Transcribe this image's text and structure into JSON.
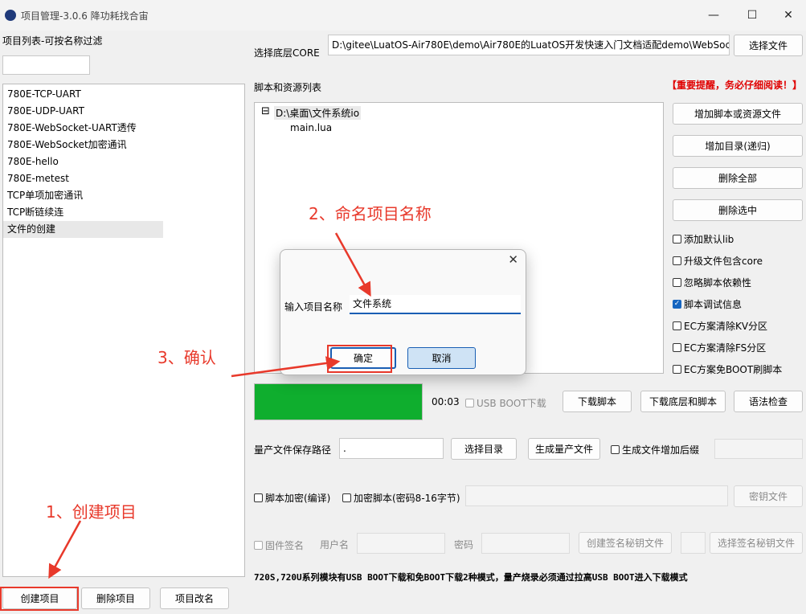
{
  "window": {
    "title": "项目管理-3.0.6 降功耗找合宙",
    "minimize_icon": "—",
    "maximize_icon": "☐",
    "close_icon": "✕"
  },
  "left": {
    "filter_label": "项目列表-可按名称过滤",
    "filter_value": "",
    "projects": [
      "780E-TCP-UART",
      "780E-UDP-UART",
      "780E-WebSocket-UART透传",
      "780E-WebSocket加密通讯",
      "780E-hello",
      "780E-metest",
      "TCP单项加密通讯",
      "TCP断链续连",
      "文件的创建"
    ],
    "selected_index": 8,
    "create_button": "创建项目",
    "delete_button": "删除项目",
    "rename_button": "项目改名"
  },
  "core": {
    "label": "选择底层CORE",
    "path": "D:\\gitee\\LuatOS-Air780E\\demo\\Air780E的LuatOS开发快速入门文档适配demo\\WebSock",
    "button": "选择文件"
  },
  "scripts": {
    "label": "脚本和资源列表",
    "warning": "【重要提醒，务必仔细阅读！】",
    "tree_root": "D:\\桌面\\文件系统io",
    "tree_collapse": "⊟",
    "tree_children": [
      "main.lua"
    ],
    "buttons": [
      "增加脚本或资源文件",
      "增加目录(递归)",
      "删除全部",
      "删除选中"
    ],
    "options": [
      {
        "label": "添加默认lib",
        "checked": false
      },
      {
        "label": "升级文件包含core",
        "checked": false
      },
      {
        "label": "忽略脚本依赖性",
        "checked": false
      },
      {
        "label": "脚本调试信息",
        "checked": true
      },
      {
        "label": "EC方案清除KV分区",
        "checked": false
      },
      {
        "label": "EC方案清除FS分区",
        "checked": false
      },
      {
        "label": "EC方案免BOOT刷脚本",
        "checked": false
      }
    ]
  },
  "download": {
    "progress": 1.0,
    "progress_color": "#0fae2e",
    "time": "00:03",
    "usb_boot_label": "USB BOOT下载",
    "download_script": "下载脚本",
    "download_core_script": "下载底层和脚本",
    "syntax_check": "语法检查"
  },
  "production": {
    "path_label": "量产文件保存路径",
    "path_value": ".",
    "choose_dir": "选择目录",
    "generate": "生成量产文件",
    "suffix_label": "生成文件增加后缀",
    "suffix_value": ""
  },
  "encrypt": {
    "compile_label": "脚本加密(编译)",
    "password_label": "加密脚本(密码8-16字节)",
    "password_value": "",
    "key_file": "密钥文件"
  },
  "signing": {
    "label": "固件签名",
    "user_label": "用户名",
    "pwd_label": "密码",
    "create_key": "创建签名秘钥文件",
    "select_key": "选择签名秘钥文件"
  },
  "note": "720S,720U系列模块有USB BOOT下载和免BOOT下载2种模式，量产烧录必须通过拉高USB BOOT进入下载模式",
  "dialog": {
    "close_icon": "✕",
    "label": "输入项目名称",
    "value": "文件系统",
    "ok": "确定",
    "cancel": "取消"
  },
  "annotations": {
    "step1": "1、创建项目",
    "step2": "2、命名项目名称",
    "step3": "3、确认",
    "color": "#e8392b"
  }
}
